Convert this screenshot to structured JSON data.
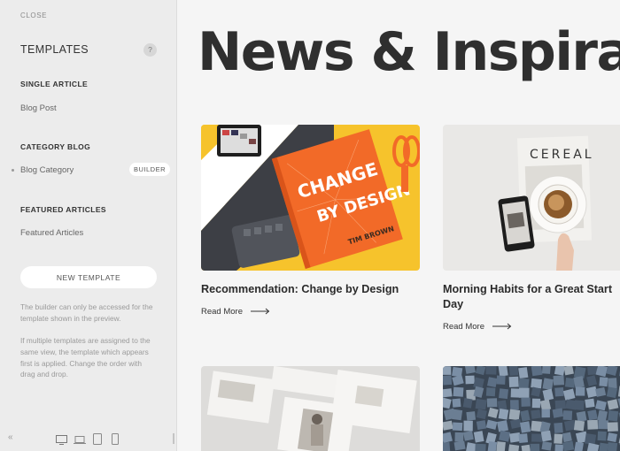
{
  "sidebar": {
    "close_label": "CLOSE",
    "title": "TEMPLATES",
    "help_label": "?",
    "sections": [
      {
        "heading": "SINGLE ARTICLE",
        "item": "Blog Post"
      },
      {
        "heading": "CATEGORY BLOG",
        "item": "Blog Category",
        "badge": "BUILDER",
        "active": true
      },
      {
        "heading": "FEATURED ARTICLES",
        "item": "Featured Articles"
      }
    ],
    "new_template_label": "NEW TEMPLATE",
    "help_text_1": "The builder can only be accessed for the template shown in the preview.",
    "help_text_2": "If multiple templates are assigned to the same view, the template which appears first is applied. Change the order with drag and drop.",
    "footer": {
      "collapse_icon": "chevron-double-left-icon",
      "devices": [
        "desktop-icon",
        "laptop-icon",
        "tablet-icon",
        "phone-icon"
      ]
    }
  },
  "preview": {
    "hero_title": "News & Inspiration",
    "cards": [
      {
        "title": "Recommendation: Change by Design",
        "link": "Read More",
        "image": "orange-book-image",
        "book_title_1": "CHANGE",
        "book_title_2": "BY DESIGN",
        "book_author": "TIM BROWN"
      },
      {
        "title": "Morning Habits for a Great Start Day",
        "link": "Read More",
        "image": "coffee-magazine-image",
        "magazine_name": "CEREAL"
      },
      {
        "title": "",
        "image": "photo-layout-image"
      },
      {
        "title": "",
        "image": "letterpress-blocks-image"
      }
    ]
  },
  "colors": {
    "sidebar_bg": "#ececec",
    "preview_bg": "#f5f5f5",
    "heading": "#2f2f2f",
    "accent_yellow": "#f5c42a",
    "accent_orange": "#f26c2a"
  }
}
